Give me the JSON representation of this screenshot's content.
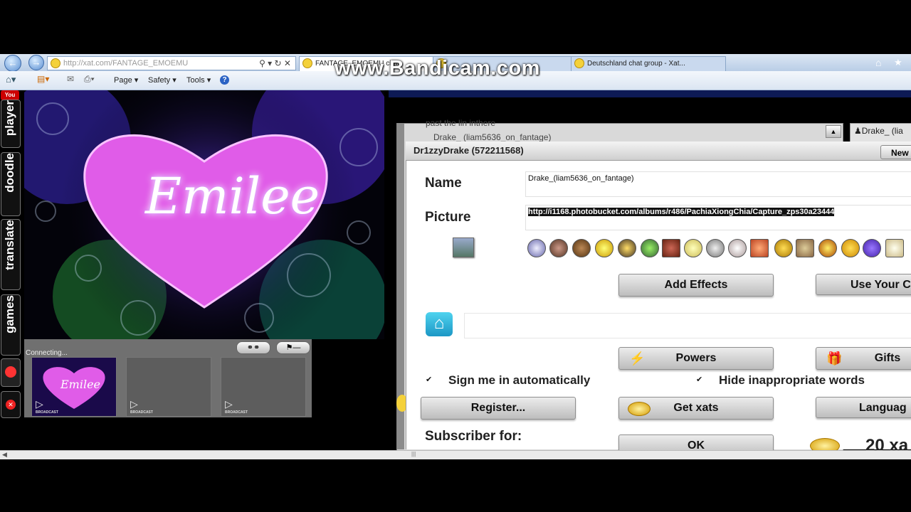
{
  "browser": {
    "address": "http://xat.com/FANTAGE_EMOEMU",
    "tabs": [
      "FANTAGE_EMOEMU chat",
      "",
      "Deutschland chat group - Xat..."
    ],
    "menu": [
      "Page",
      "Safety",
      "Tools"
    ]
  },
  "watermark": "www.Bandicam.com",
  "sidebar": [
    "player",
    "doodle",
    "translate",
    "games"
  ],
  "youtube_label": "You Tube",
  "banner_text": "Emilee",
  "connecting_text": "Connecting...",
  "broadcast_label": "BROADCAST",
  "chat": {
    "line1": "past the lin inthere",
    "line2": "Drake_ (liam5636_on_fantage)",
    "right_user": "Drake_ (lia"
  },
  "dialog": {
    "title": "Dr1zzyDrake (572211568)",
    "new_button": "New",
    "name_label": "Name",
    "name_value": "Drake_(liam5636_on_fantage)",
    "picture_label": "Picture",
    "picture_url": "http://i1168.photobucket.com/albums/r486/PachiaXiongChia/Capture_zps30a23444",
    "buttons": {
      "add_effects": "Add Effects",
      "use_your": "Use Your C",
      "powers": "Powers",
      "gifts": "Gifts",
      "register": "Register...",
      "get_xats": "Get xats",
      "language": "Languag",
      "ok": "OK"
    },
    "sign_in": "Sign me in automatically",
    "hide_words": "Hide inappropriate words",
    "subscriber": "Subscriber for:",
    "xats": "20 xa"
  },
  "colors": {
    "heart": "#e05ce8",
    "dialog_bg": "#ffffff",
    "chrome": "#c6d8ee"
  }
}
